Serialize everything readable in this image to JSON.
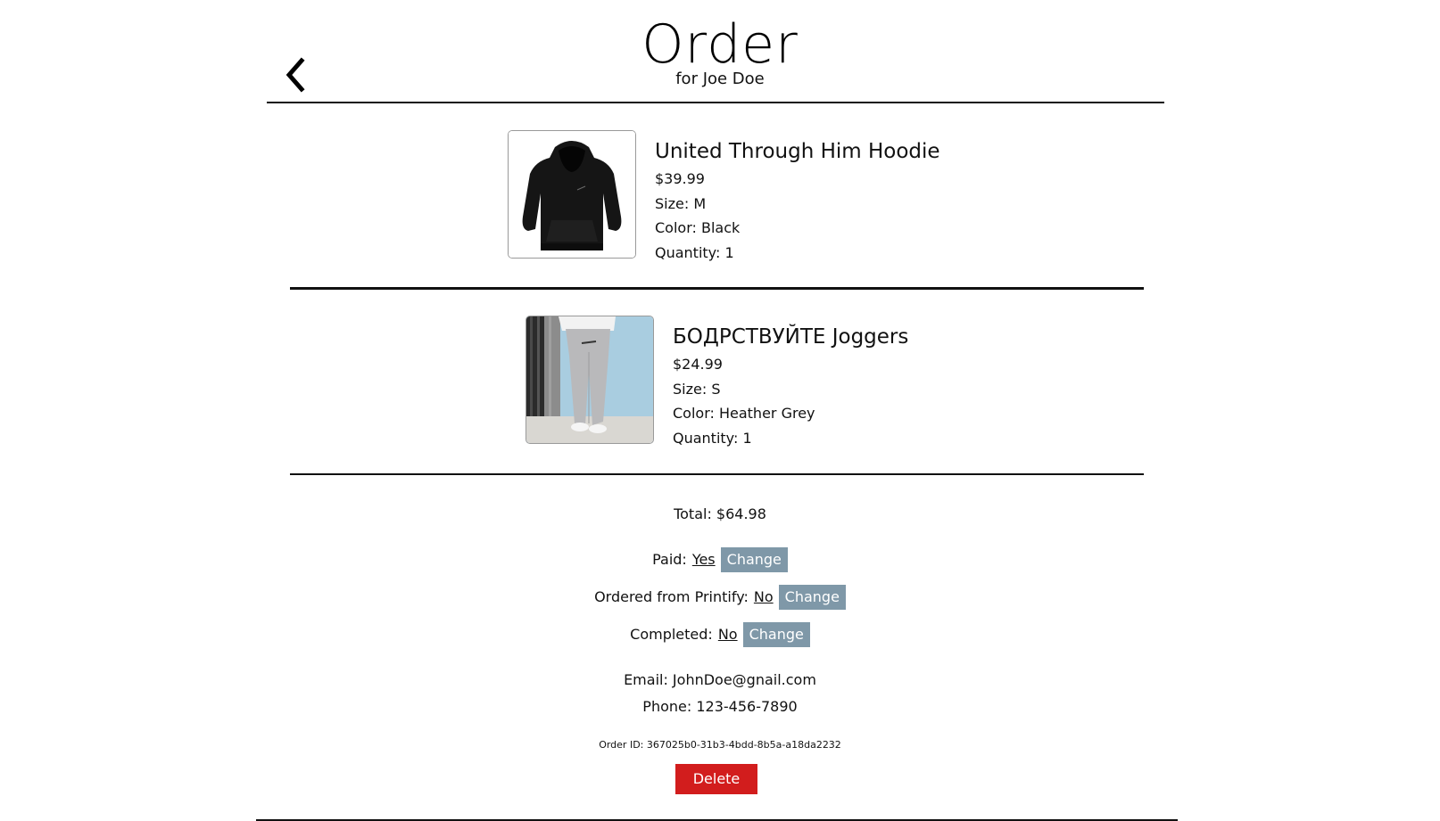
{
  "header": {
    "title": "Order",
    "subtitle": "for Joe Doe",
    "back_icon": "chevron-left-icon"
  },
  "items": [
    {
      "name": "United Through Him Hoodie",
      "price": "$39.99",
      "size": "Size: M",
      "color": "Color: Black",
      "quantity": "Quantity: 1",
      "image": "black-hoodie-photo"
    },
    {
      "name": "БОДРСТВУЙТЕ Joggers",
      "price": "$24.99",
      "size": "Size: S",
      "color": "Color: Heather Grey",
      "quantity": "Quantity: 1",
      "image": "grey-joggers-photo"
    }
  ],
  "total": "Total: $64.98",
  "status": {
    "paid": {
      "label": "Paid:",
      "value": "Yes",
      "button": "Change"
    },
    "printify": {
      "label": "Ordered from Printify:",
      "value": "No",
      "button": "Change"
    },
    "completed": {
      "label": "Completed:",
      "value": "No",
      "button": "Change"
    }
  },
  "contact": {
    "email": "Email: JohnDoe@gnail.com",
    "phone": "Phone: 123-456-7890"
  },
  "order_id": "Order ID: 367025b0-31b3-4bdd-8b5a-a18da2232",
  "delete_label": "Delete",
  "colors": {
    "change_button": "#7f98a8",
    "delete_button": "#d21d1d",
    "rule": "#111111"
  }
}
